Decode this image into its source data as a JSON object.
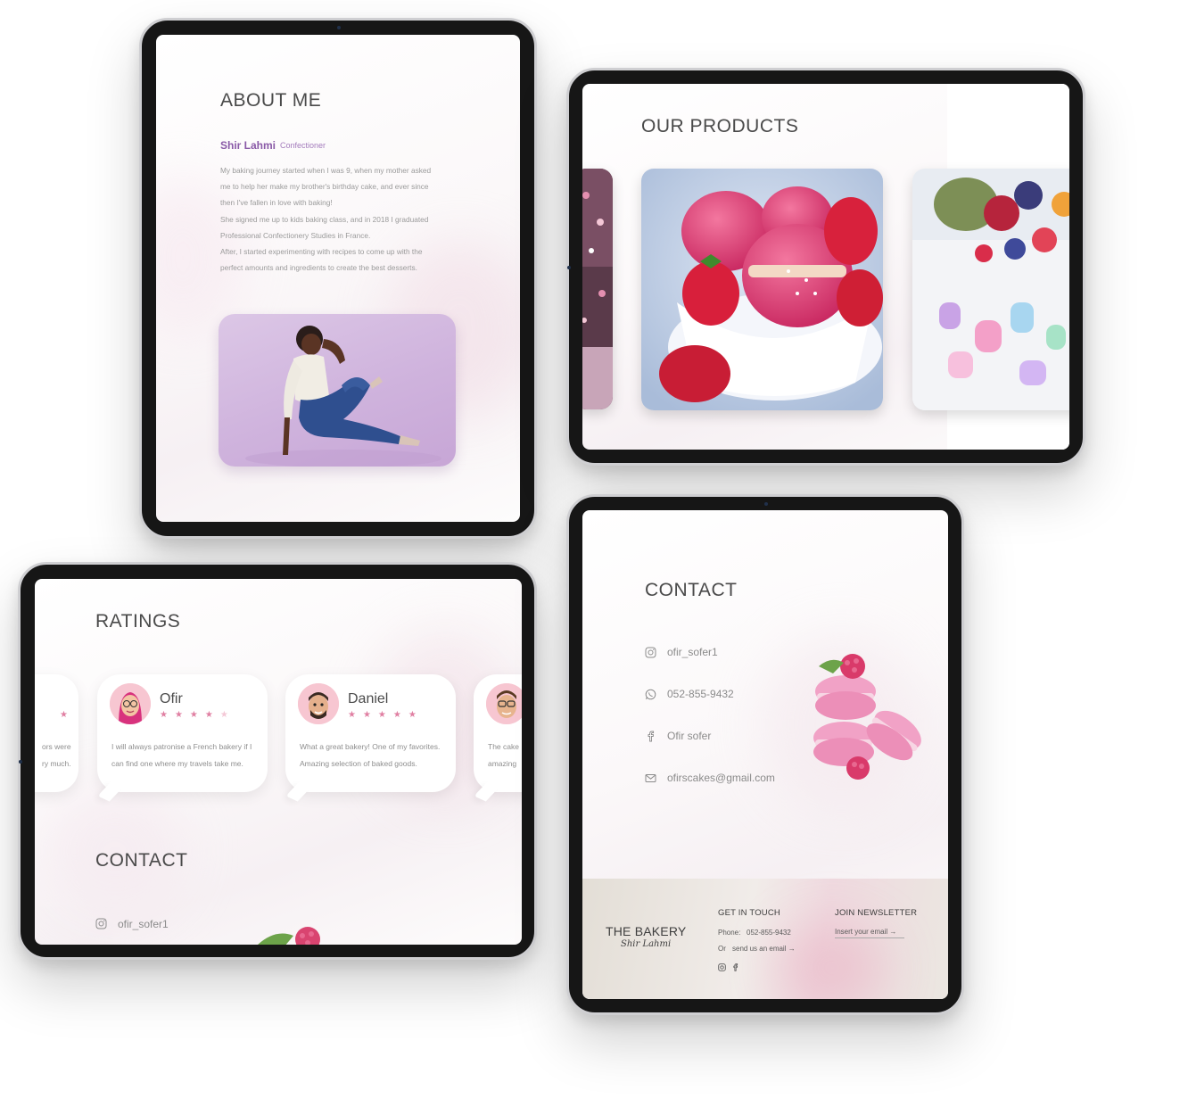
{
  "about": {
    "title": "ABOUT ME",
    "name": "Shir Lahmi",
    "role": "Confectioner",
    "bio": [
      "My baking journey started when I was 9, when my mother asked",
      "me to help her make my brother's birthday cake, and ever since",
      "then I've fallen in love with baking!",
      "She signed me up to kids baking class, and in 2018 I graduated",
      "Professional Confectionery Studies in France.",
      "After, I started experimenting with recipes to come up with the",
      "perfect amounts and ingredients to create the best desserts."
    ]
  },
  "products": {
    "title": "OUR PRODUCTS",
    "items": [
      "macarons-strawberries-image",
      "berry-cake-image",
      "chocolate-cake-image"
    ]
  },
  "ratings": {
    "title": "RATINGS",
    "partial_left": {
      "line1": "ors were",
      "line2": "ry much."
    },
    "reviews": [
      {
        "name": "Ofir",
        "stars": 4,
        "text_line1": "I will always patronise a French bakery if I",
        "text_line2": "can find one where my travels take me."
      },
      {
        "name": "Daniel",
        "stars": 5,
        "text_line1": "What a great bakery! One of my favorites.",
        "text_line2": "Amazing selection of baked goods."
      }
    ],
    "partial_right": {
      "line1": "The cake",
      "line2": "amazing"
    },
    "contact_title": "CONTACT",
    "contact_instagram": "ofir_sofer1"
  },
  "contact": {
    "title": "CONTACT",
    "instagram": "ofir_sofer1",
    "whatsapp": "052-855-9432",
    "facebook": "Ofir sofer",
    "email": "ofirscakes@gmail.com"
  },
  "footer": {
    "brand": "THE BAKERY",
    "signature": "Shir Lahmi",
    "get_in_touch": "GET IN TOUCH",
    "phone_label": "Phone:",
    "phone": "052-855-9432",
    "or_label": "Or",
    "email_link": "send us an email",
    "newsletter_title": "JOIN NEWSLETTER",
    "newsletter_placeholder": "Insert your email"
  },
  "colors": {
    "accent_purple": "#8a5aa7",
    "star_pink": "#e07fa2",
    "tablet_bezel": "#161616"
  }
}
